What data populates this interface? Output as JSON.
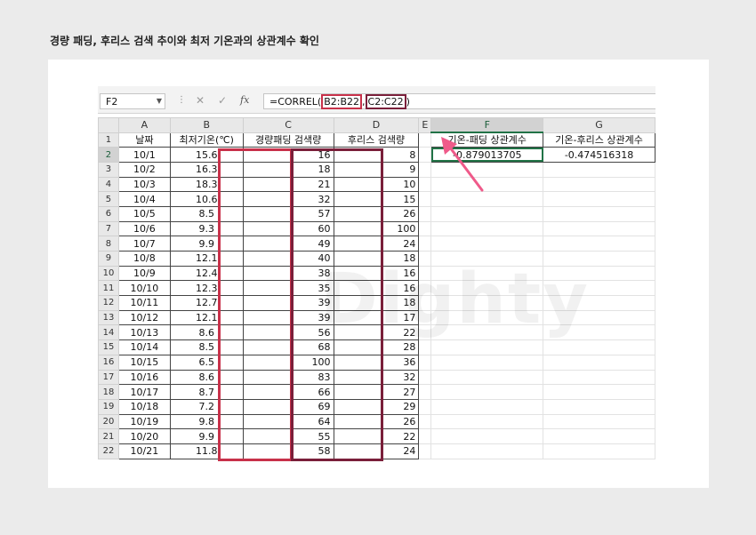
{
  "page_title": "경량 패딩, 후리스 검색 추이와 최저 기온과의 상관계수 확인",
  "watermark": "Dighty",
  "formula_bar": {
    "name_box": "F2",
    "formula_prefix": "=CORREL(",
    "ref1": "B2:B22",
    "separator": ",",
    "ref2": "C2:C22",
    "formula_suffix": ")"
  },
  "columns": [
    "A",
    "B",
    "C",
    "D",
    "E",
    "F",
    "G"
  ],
  "headers": {
    "a": "날짜",
    "b": "최저기온(℃)",
    "c": "경량패딩 검색량",
    "d": "후리스 검색량",
    "f": "기온-패딩 상관계수",
    "g": "기온-후리스 상관계수"
  },
  "results": {
    "f2": "-0.879013705",
    "g2": "-0.474516318"
  },
  "rows": [
    {
      "n": "2",
      "date": "10/1",
      "temp": "15.6",
      "padding": "16",
      "fleece": "8"
    },
    {
      "n": "3",
      "date": "10/2",
      "temp": "16.3",
      "padding": "18",
      "fleece": "9"
    },
    {
      "n": "4",
      "date": "10/3",
      "temp": "18.3",
      "padding": "21",
      "fleece": "10"
    },
    {
      "n": "5",
      "date": "10/4",
      "temp": "10.6",
      "padding": "32",
      "fleece": "15"
    },
    {
      "n": "6",
      "date": "10/5",
      "temp": "8.5",
      "padding": "57",
      "fleece": "26"
    },
    {
      "n": "7",
      "date": "10/6",
      "temp": "9.3",
      "padding": "60",
      "fleece": "100"
    },
    {
      "n": "8",
      "date": "10/7",
      "temp": "9.9",
      "padding": "49",
      "fleece": "24"
    },
    {
      "n": "9",
      "date": "10/8",
      "temp": "12.1",
      "padding": "40",
      "fleece": "18"
    },
    {
      "n": "10",
      "date": "10/9",
      "temp": "12.4",
      "padding": "38",
      "fleece": "16"
    },
    {
      "n": "11",
      "date": "10/10",
      "temp": "12.3",
      "padding": "35",
      "fleece": "16"
    },
    {
      "n": "12",
      "date": "10/11",
      "temp": "12.7",
      "padding": "39",
      "fleece": "18"
    },
    {
      "n": "13",
      "date": "10/12",
      "temp": "12.1",
      "padding": "39",
      "fleece": "17"
    },
    {
      "n": "14",
      "date": "10/13",
      "temp": "8.6",
      "padding": "56",
      "fleece": "22"
    },
    {
      "n": "15",
      "date": "10/14",
      "temp": "8.5",
      "padding": "68",
      "fleece": "28"
    },
    {
      "n": "16",
      "date": "10/15",
      "temp": "6.5",
      "padding": "100",
      "fleece": "36"
    },
    {
      "n": "17",
      "date": "10/16",
      "temp": "8.6",
      "padding": "83",
      "fleece": "32"
    },
    {
      "n": "18",
      "date": "10/17",
      "temp": "8.7",
      "padding": "66",
      "fleece": "27"
    },
    {
      "n": "19",
      "date": "10/18",
      "temp": "7.2",
      "padding": "69",
      "fleece": "29"
    },
    {
      "n": "20",
      "date": "10/19",
      "temp": "9.8",
      "padding": "64",
      "fleece": "26"
    },
    {
      "n": "21",
      "date": "10/20",
      "temp": "9.9",
      "padding": "55",
      "fleece": "22"
    },
    {
      "n": "22",
      "date": "10/21",
      "temp": "11.8",
      "padding": "58",
      "fleece": "24"
    }
  ],
  "colors": {
    "ref1_highlight": "#c8314a",
    "ref2_highlight": "#7a1f3a",
    "arrow": "#ef5a8a",
    "selection": "#217346"
  }
}
